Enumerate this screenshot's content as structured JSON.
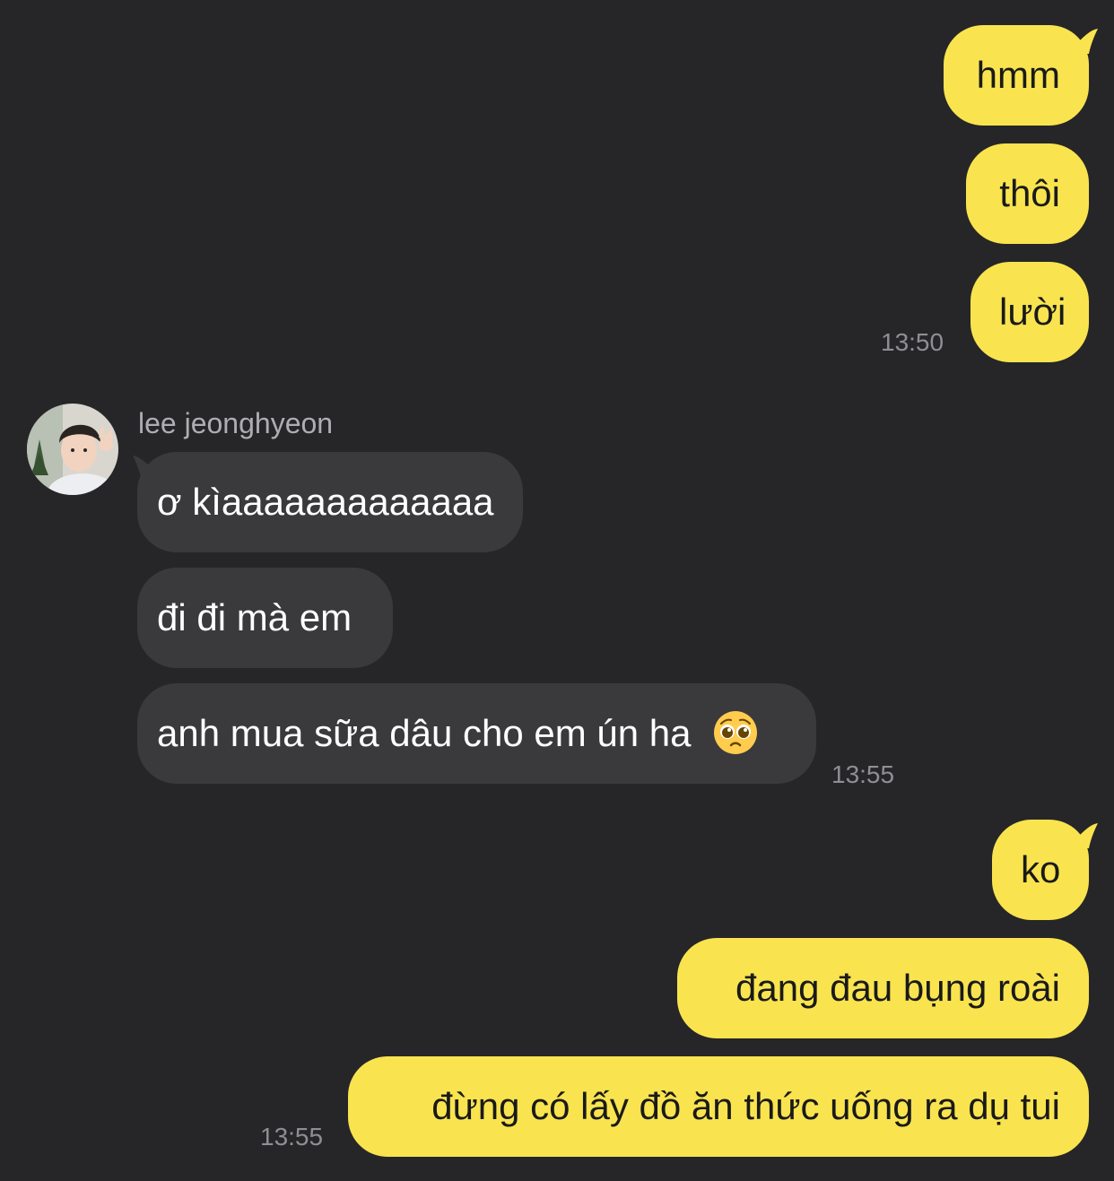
{
  "chat": {
    "contact_name": "lee jeonghyeon",
    "messages_group1": {
      "m1": "hmm",
      "m2": "thôi",
      "m3": "lười",
      "time": "13:50"
    },
    "messages_group2": {
      "m1": "ơ kìaaaaaaaaaaaaa",
      "m2": "đi đi mà em",
      "m3": "anh mua sữa dâu cho em ún ha",
      "m3_emoji": "pleading-face-emoji",
      "time": "13:55"
    },
    "messages_group3": {
      "m1": "ko",
      "m2": "đang đau bụng roài",
      "m3": "đừng có lấy đồ ăn thức uống ra dụ tui",
      "time": "13:55"
    }
  },
  "colors": {
    "background": "#262628",
    "outgoing_bubble": "#F9E44F",
    "incoming_bubble": "#3A3A3C",
    "timestamp": "#8E8E93"
  }
}
